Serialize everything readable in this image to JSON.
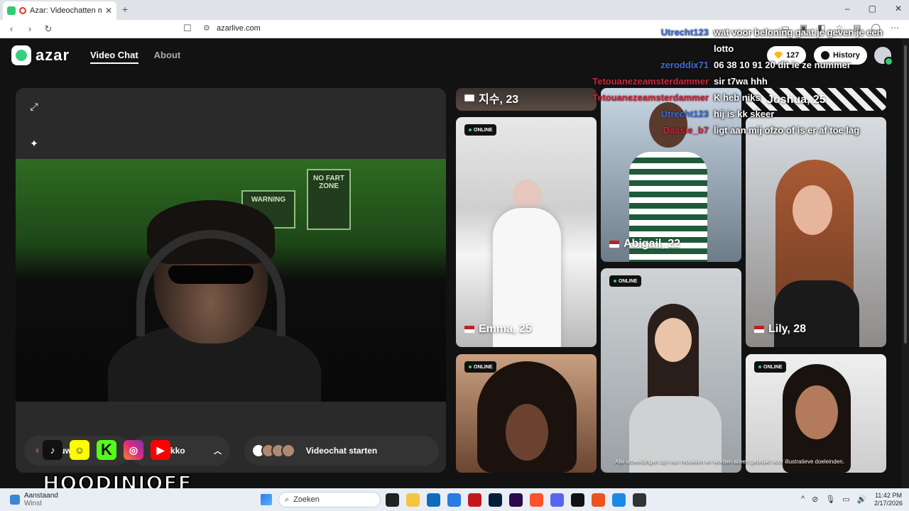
{
  "browser": {
    "tab_title": "Azar: Videochatten met nieu…",
    "url": "azarlive.com",
    "icons": [
      "back-icon",
      "forward-icon",
      "reload-icon",
      "bookmark-icon",
      "site-info-icon",
      "new-tab-icon"
    ],
    "window_controls": [
      "minimize",
      "maximize",
      "close"
    ]
  },
  "site": {
    "logo": "azar",
    "nav": [
      "Video Chat",
      "About"
    ],
    "gems": "127",
    "history": "History",
    "tools": [
      "expand-icon",
      "magic-wand-icon",
      "sticker-icon"
    ],
    "filters": {
      "gender": "Vrouwelijk",
      "country": "Marokko",
      "start": "Videochat starten"
    }
  },
  "video": {
    "signs": [
      "WARNING",
      "NO FART ZONE"
    ]
  },
  "profiles": [
    {
      "name": "지수, 23",
      "flag": "kr",
      "online": false
    },
    {
      "name": "Joshua, 25",
      "flag": "us",
      "online": false
    },
    {
      "name": "Emma, 25",
      "flag": "us",
      "online": true
    },
    {
      "name": "Abigail, 22",
      "flag": "us",
      "online": false
    },
    {
      "name": "Lily, 28",
      "flag": "us",
      "online": true
    },
    {
      "name": "",
      "flag": "",
      "online": true
    },
    {
      "name": "",
      "flag": "",
      "online": true
    },
    {
      "name": "",
      "flag": "",
      "online": true
    }
  ],
  "online_label": "ONLINE",
  "disclaimer": "Alle afbeeldingen zijn van modellen en worden alleen gebruikt voor illustratieve doeleinden.",
  "chat": [
    {
      "user": "Utrecht123",
      "text": "wat voor beloning gaat je geven je een",
      "color": "#3b6fd9"
    },
    {
      "user": "",
      "text": "lotto",
      "color": "#ffffff"
    },
    {
      "user": "zeroddix71",
      "text": "06 38 10 91 20 dit ie ze nummer",
      "color": "#3b6fd9"
    },
    {
      "user": "Tetouanezeamsterdammer",
      "text": "sir t7wa hhh",
      "color": "#d0263a"
    },
    {
      "user": "Tetouanezeamsterdammer",
      "text": "K heb niks",
      "color": "#d0263a"
    },
    {
      "user": "Utrecht123",
      "text": "hij is kk skeer",
      "color": "#3b6fd9"
    },
    {
      "user": "Dassie_b7",
      "text": "ligt aan mij ofzo of is er af toe lag",
      "color": "#d0263a"
    }
  ],
  "streamer": {
    "name": "HOODINIOFF",
    "socials": [
      "tiktok-icon",
      "snapchat-icon",
      "kick-icon",
      "instagram-icon",
      "youtube-icon"
    ]
  },
  "taskbar": {
    "weather_title": "Aanstaand",
    "weather_sub": "Winst",
    "search": "Zoeken",
    "time": "11:42 PM",
    "date": "2/17/2026"
  }
}
